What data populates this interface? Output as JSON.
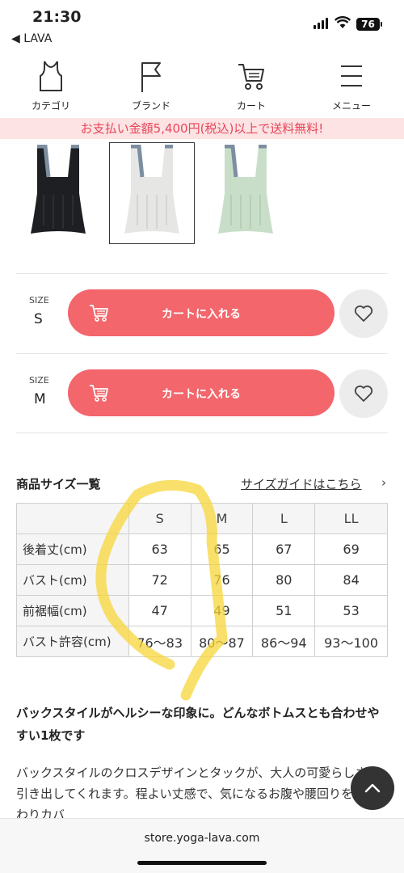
{
  "status": {
    "time": "21:30",
    "back_app": "◀ LAVA",
    "battery": "76"
  },
  "nav": {
    "items": [
      {
        "label": "カテゴリ",
        "icon": "tank-top-icon"
      },
      {
        "label": "ブランド",
        "icon": "flag-icon"
      },
      {
        "label": "カート",
        "icon": "cart-icon"
      },
      {
        "label": "メニュー",
        "icon": "menu-icon"
      }
    ]
  },
  "banner": {
    "text": "お支払い金額5,400円(税込)以上で送料無料!"
  },
  "thumbnails": [
    {
      "color": "black",
      "fill": "#1d1f22",
      "selected": false
    },
    {
      "color": "white",
      "fill": "#e9e9e7",
      "selected": true
    },
    {
      "color": "mint",
      "fill": "#c9dec8",
      "selected": false
    }
  ],
  "cart_rows": [
    {
      "size_caption": "SIZE",
      "size": "S",
      "button": "カートに入れる"
    },
    {
      "size_caption": "SIZE",
      "size": "M",
      "button": "カートに入れる"
    }
  ],
  "size_table": {
    "heading": "商品サイズ一覧",
    "guide_link": "サイズガイドはこちら",
    "guide_arrow": "›",
    "columns": [
      "",
      "S",
      "M",
      "L",
      "LL"
    ],
    "rows": [
      {
        "label": "後着丈(cm)",
        "values": [
          "63",
          "65",
          "67",
          "69"
        ]
      },
      {
        "label": "バスト(cm)",
        "values": [
          "72",
          "76",
          "80",
          "84"
        ]
      },
      {
        "label": "前裾幅(cm)",
        "values": [
          "47",
          "49",
          "51",
          "53"
        ]
      },
      {
        "label": "バスト許容(cm)",
        "values": [
          "76〜83",
          "80〜87",
          "86〜94",
          "93〜100"
        ]
      }
    ]
  },
  "description": {
    "title": "バックスタイルがヘルシーな印象に。どんなボトムスとも合わせやすい1枚です",
    "body": "バックスタイルのクロスデザインとタックが、大人の可愛らしさを引き出してくれます。程よい丈感で、気になるお腹や腰回りをふんわりカバ"
  },
  "browser": {
    "url": "store.yoga-lava.com"
  },
  "colors": {
    "accent": "#f2666c",
    "banner_text": "#e8465a",
    "highlight": "#f7d53a"
  }
}
